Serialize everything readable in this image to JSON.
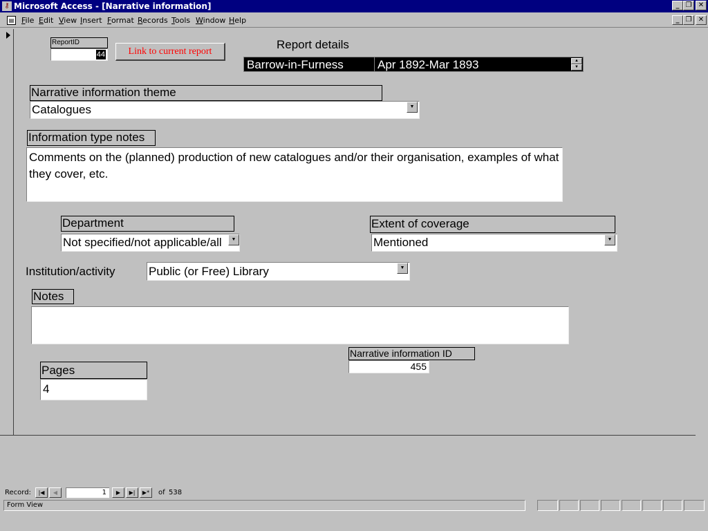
{
  "window": {
    "title": "Microsoft Access - [Narrative information]",
    "app_icon": "access-key-icon"
  },
  "menu": [
    "File",
    "Edit",
    "View",
    "Insert",
    "Format",
    "Records",
    "Tools",
    "Window",
    "Help"
  ],
  "form": {
    "report_id": {
      "label": "ReportID",
      "value": "44"
    },
    "link_button": "Link to current report",
    "report_details": {
      "label": "Report details",
      "place": "Barrow-in-Furness",
      "period": "Apr 1892-Mar 1893"
    },
    "theme": {
      "label": "Narrative information theme",
      "value": "Catalogues"
    },
    "type_notes": {
      "label": "Information type notes",
      "value": "Comments on the (planned) production of new catalogues and/or their organisation, examples of what they cover, etc."
    },
    "department": {
      "label": "Department",
      "value": "Not specified/not applicable/all"
    },
    "extent": {
      "label": "Extent of coverage",
      "value": "Mentioned"
    },
    "institution": {
      "label": "Institution/activity",
      "value": "Public (or Free) Library"
    },
    "notes": {
      "label": "Notes",
      "value": ""
    },
    "narrative_id": {
      "label": "Narrative information ID",
      "value": "455"
    },
    "pages": {
      "label": "Pages",
      "value": "4"
    }
  },
  "navigation": {
    "label": "Record:",
    "current": "1",
    "of_label": "of",
    "total": "538"
  },
  "status": {
    "text": "Form View"
  },
  "colors": {
    "title_bar": "#000080",
    "face": "#c0c0c0",
    "link_text": "#ff0000",
    "selected_bg": "#000000"
  }
}
